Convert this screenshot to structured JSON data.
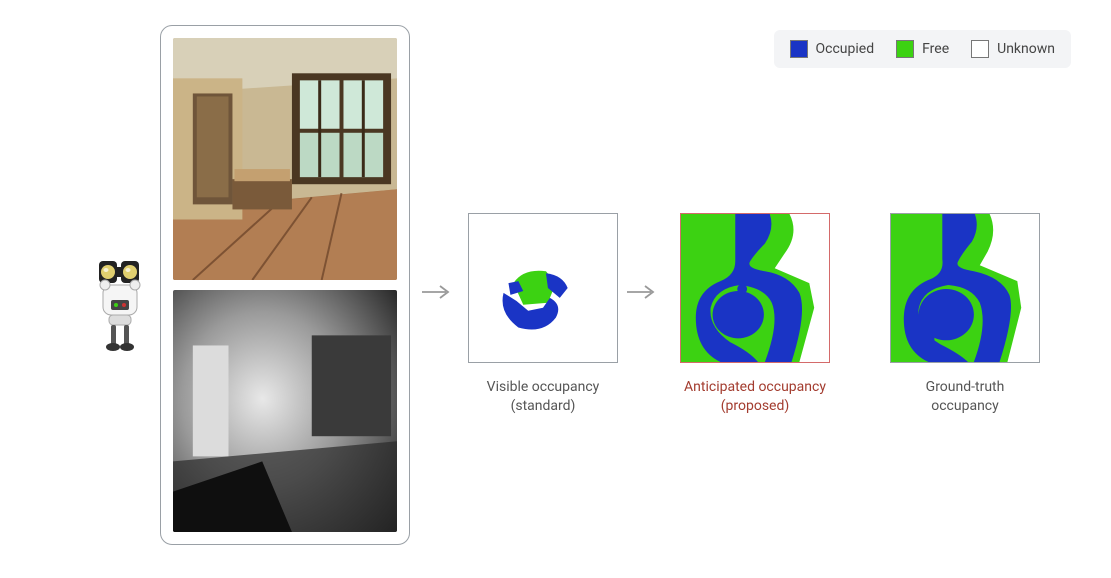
{
  "legend": {
    "occupied": "Occupied",
    "free": "Free",
    "unknown": "Unknown",
    "colors": {
      "occupied": "#1a34c5",
      "free": "#3cd212",
      "unknown": "#ffffff"
    }
  },
  "inputs": {
    "top": "rgb-image",
    "bottom": "depth-image"
  },
  "maps": {
    "visible": {
      "label_line1": "Visible occupancy",
      "label_line2": "(standard)"
    },
    "anticipated": {
      "label_line1": "Anticipated occupancy",
      "label_line2": "(proposed)"
    },
    "ground_truth": {
      "label_line1": "Ground-truth",
      "label_line2": "occupancy"
    }
  },
  "arrow_glyph": "→"
}
